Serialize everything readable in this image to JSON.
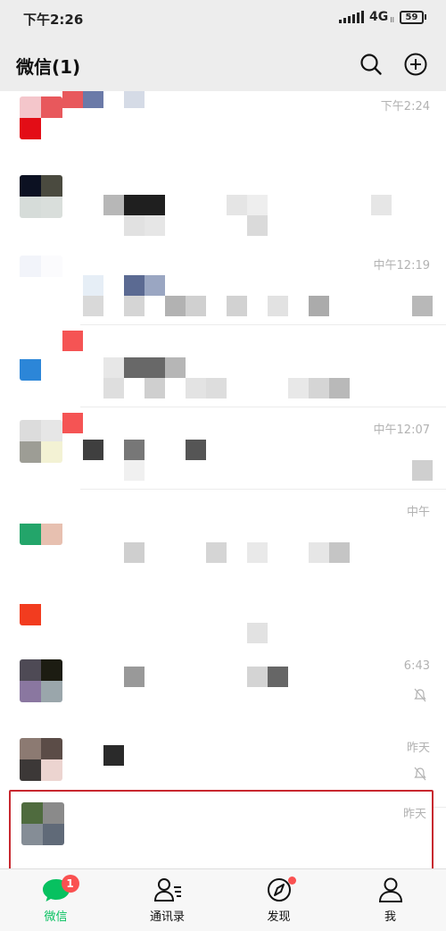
{
  "status_bar": {
    "time": "下午2:26",
    "network": "4G",
    "network_sub": "II",
    "battery": "59"
  },
  "header": {
    "title": "微信(1)",
    "search_icon": "search-icon",
    "add_icon": "add-circle-icon"
  },
  "chats": [
    {
      "time": "下午2:24",
      "sub_icon": "",
      "avatar": [
        "#f4c6cb",
        "#e8585c",
        "#e30d16",
        "#ffffff"
      ]
    },
    {
      "time": "",
      "sub_icon": "",
      "avatar": [
        "#0c1122",
        "#4a4a3f",
        "#d6dcd9",
        "#d9dedb"
      ]
    },
    {
      "time": "中午12:19",
      "sub_icon": "",
      "avatar": [
        "#f2f4fa",
        "#fbfbfd",
        "#ffffff",
        "#ffffff"
      ]
    },
    {
      "time": "",
      "sub_icon": "",
      "avatar": [
        "#ffffff",
        "#ffffff",
        "#2c86d8",
        "#ffffff"
      ]
    },
    {
      "time": "中午12:07",
      "sub_icon": "",
      "avatar": [
        "#dcdcdc",
        "#e6e6e6",
        "#9d9d95",
        "#f3f2d4"
      ]
    },
    {
      "time": "中午",
      "sub_icon": "",
      "avatar": [
        "#ffffff",
        "#ffffff",
        "#23a56a",
        "#e7c0b0"
      ]
    },
    {
      "time": "",
      "sub_icon": "",
      "avatar": [
        "#ffffff",
        "#ffffff",
        "#f23c1f",
        "#ffffff"
      ]
    },
    {
      "time": "6:43",
      "sub_icon": "mute-bell-icon",
      "avatar": [
        "#4e4a55",
        "#1c1c12",
        "#8a77a0",
        "#9aa6ab"
      ]
    },
    {
      "time": "昨天",
      "sub_icon": "mute-bell-icon",
      "avatar": [
        "#8c7a72",
        "#5b4c47",
        "#3c3837",
        "#ecd4d0"
      ]
    },
    {
      "time": "昨天",
      "sub_icon": "",
      "avatar": [
        "#4f6b3e",
        "#8a8a8a",
        "#858d96",
        "#606a78"
      ]
    }
  ],
  "tabs": [
    {
      "label": "微信",
      "icon": "chat-bubble-icon",
      "badge": "1"
    },
    {
      "label": "通讯录",
      "icon": "contacts-icon",
      "badge": ""
    },
    {
      "label": "发现",
      "icon": "compass-icon",
      "badge": ""
    },
    {
      "label": "我",
      "icon": "person-icon",
      "badge": ""
    }
  ],
  "colors": {
    "accent": "#07c160",
    "badge": "#fa5151",
    "highlight_border": "#c8282f",
    "header_bg": "#ededed"
  }
}
